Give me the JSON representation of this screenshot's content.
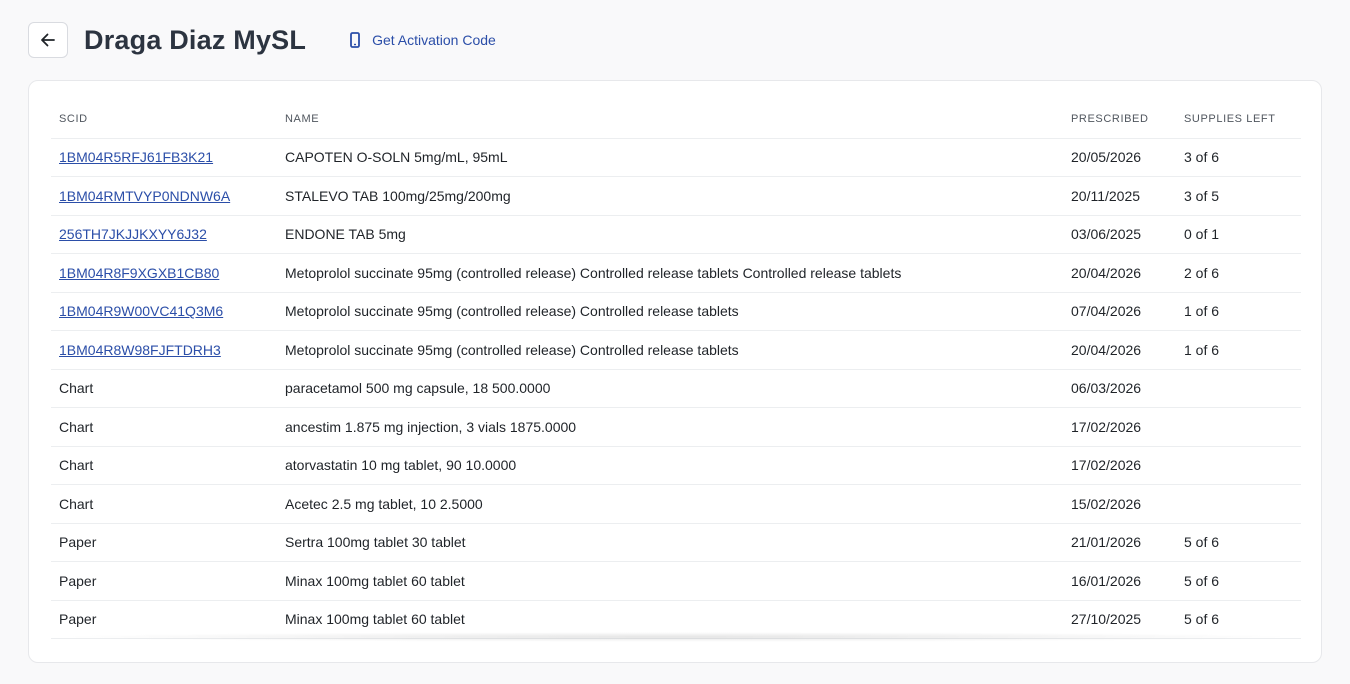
{
  "header": {
    "title": "Draga Diaz MySL",
    "activation_label": "Get Activation Code"
  },
  "table": {
    "columns": [
      "SCID",
      "NAME",
      "PRESCRIBED",
      "SUPPLIES LEFT"
    ],
    "rows": [
      {
        "scid": "1BM04R5RFJ61FB3K21",
        "link": true,
        "name": "CAPOTEN O-SOLN 5mg/mL, 95mL",
        "prescribed": "20/05/2026",
        "supplies": "3 of 6"
      },
      {
        "scid": "1BM04RMTVYP0NDNW6A",
        "link": true,
        "name": "STALEVO TAB 100mg/25mg/200mg",
        "prescribed": "20/11/2025",
        "supplies": "3 of 5"
      },
      {
        "scid": "256TH7JKJJKXYY6J32",
        "link": true,
        "name": "ENDONE TAB 5mg",
        "prescribed": "03/06/2025",
        "supplies": "0 of 1"
      },
      {
        "scid": "1BM04R8F9XGXB1CB80",
        "link": true,
        "name": "Metoprolol succinate 95mg (controlled release) Controlled release tablets Controlled release tablets",
        "prescribed": "20/04/2026",
        "supplies": "2 of 6"
      },
      {
        "scid": "1BM04R9W00VC41Q3M6",
        "link": true,
        "name": "Metoprolol succinate 95mg (controlled release) Controlled release tablets",
        "prescribed": "07/04/2026",
        "supplies": "1 of 6"
      },
      {
        "scid": "1BM04R8W98FJFTDRH3",
        "link": true,
        "name": "Metoprolol succinate 95mg (controlled release) Controlled release tablets",
        "prescribed": "20/04/2026",
        "supplies": "1 of 6"
      },
      {
        "scid": "Chart",
        "link": false,
        "name": "paracetamol 500 mg capsule, 18 500.0000",
        "prescribed": "06/03/2026",
        "supplies": ""
      },
      {
        "scid": "Chart",
        "link": false,
        "name": "ancestim 1.875 mg injection, 3 vials 1875.0000",
        "prescribed": "17/02/2026",
        "supplies": ""
      },
      {
        "scid": "Chart",
        "link": false,
        "name": "atorvastatin 10 mg tablet, 90 10.0000",
        "prescribed": "17/02/2026",
        "supplies": ""
      },
      {
        "scid": "Chart",
        "link": false,
        "name": "Acetec 2.5 mg tablet, 10 2.5000",
        "prescribed": "15/02/2026",
        "supplies": ""
      },
      {
        "scid": "Paper",
        "link": false,
        "name": "Sertra 100mg tablet 30 tablet",
        "prescribed": "21/01/2026",
        "supplies": "5 of 6"
      },
      {
        "scid": "Paper",
        "link": false,
        "name": "Minax 100mg tablet 60 tablet",
        "prescribed": "16/01/2026",
        "supplies": "5 of 6"
      },
      {
        "scid": "Paper",
        "link": false,
        "name": "Minax 100mg tablet 60 tablet",
        "prescribed": "27/10/2025",
        "supplies": "5 of 6"
      }
    ]
  },
  "icons": {
    "back": "arrow-left-icon",
    "activation": "mobile-phone-icon"
  },
  "colors": {
    "link": "#2b4ea8",
    "title": "#2c3440",
    "background": "#f9f9fa"
  }
}
